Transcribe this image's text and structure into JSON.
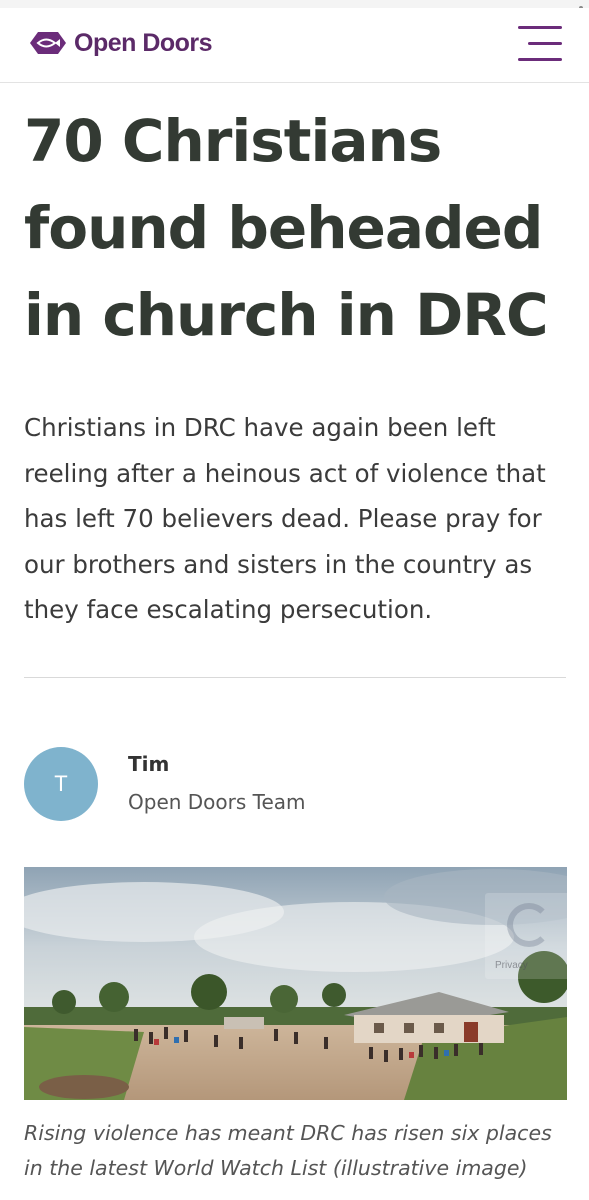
{
  "header": {
    "logo_text": "Open Doors",
    "brand_color": "#5b2a68",
    "menu_icon": "hamburger-menu-icon"
  },
  "article": {
    "title_lines": [
      "70 Christians",
      "found beheaded",
      "in church in DRC"
    ],
    "intro": "Christians in DRC have again been left reeling after a heinous act of violence that has left 70 believers dead. Please pray for our brothers and sisters in the country as they face escalating persecution.",
    "author": {
      "initial": "T",
      "name": "Tim",
      "role": "Open Doors Team",
      "avatar_color": "#7fb3cd"
    },
    "image": {
      "caption": "Rising violence has meant DRC has risen six places in the latest World Watch List (illustrative image)"
    },
    "recaptcha_label": "Privacy"
  }
}
